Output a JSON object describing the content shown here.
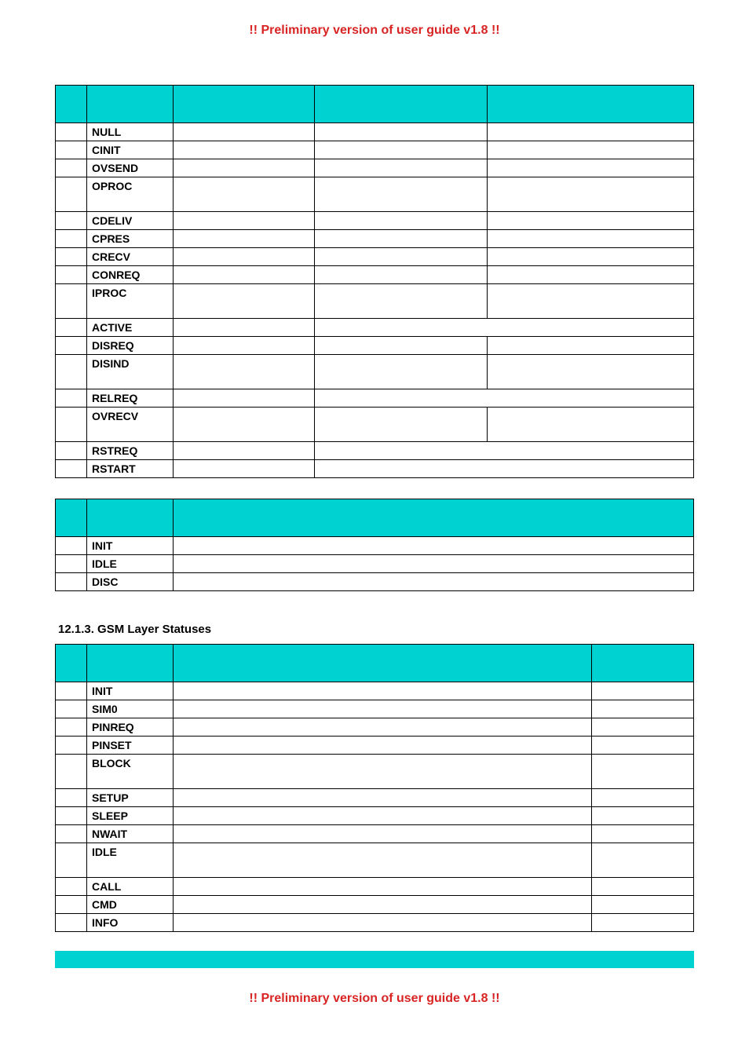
{
  "banner_top": "!! Preliminary version of user guide v1.8 !!",
  "banner_bottom": "!! Preliminary version of user guide v1.8 !!",
  "section1": {
    "headers": [
      "",
      "",
      "",
      "",
      ""
    ],
    "rows": [
      {
        "id": "",
        "code": "NULL",
        "c3": "",
        "c4": "",
        "c5": "",
        "tall": false
      },
      {
        "id": "",
        "code": "CINIT",
        "c3": "",
        "c4": "",
        "c5": "",
        "tall": false
      },
      {
        "id": "",
        "code": "OVSEND",
        "c3": "",
        "c4": "",
        "c5": "",
        "tall": false
      },
      {
        "id": "",
        "code": "OPROC",
        "c3": "",
        "c4": "",
        "c5": "",
        "tall": true
      },
      {
        "id": "",
        "code": "CDELIV",
        "c3": "",
        "c4": "",
        "c5": "",
        "tall": false
      },
      {
        "id": "",
        "code": "CPRES",
        "c3": "",
        "c4": "",
        "c5": "",
        "tall": false
      },
      {
        "id": "",
        "code": "CRECV",
        "c3": "",
        "c4": "",
        "c5": "",
        "tall": false
      },
      {
        "id": "",
        "code": "CONREQ",
        "c3": "",
        "c4": "",
        "c5": "",
        "tall": false
      },
      {
        "id": "",
        "code": "IPROC",
        "c3": "",
        "c4": "",
        "c5": "",
        "tall": true
      },
      {
        "id": "",
        "code": "ACTIVE",
        "c3": "",
        "c45": "",
        "span45": true,
        "tall": false
      },
      {
        "id": "",
        "code": "DISREQ",
        "c3": "",
        "c4": "",
        "c5": "",
        "tall": false
      },
      {
        "id": "",
        "code": "DISIND",
        "c3": "",
        "c4": "",
        "c5": "",
        "tall": true
      },
      {
        "id": "",
        "code": "RELREQ",
        "c3": "",
        "c45": "",
        "span45": true,
        "tall": false
      },
      {
        "id": "",
        "code": "OVRECV",
        "c3": "",
        "c4": "",
        "c5": "",
        "tall": true
      },
      {
        "id": "",
        "code": "RSTREQ",
        "c3": "",
        "c45": "",
        "span45": true,
        "tall": false
      },
      {
        "id": "",
        "code": "RSTART",
        "c3": "",
        "c45": "",
        "span45": true,
        "tall": false
      }
    ]
  },
  "section2": {
    "headers": [
      "",
      "",
      ""
    ],
    "rows": [
      {
        "id": "",
        "code": "INIT",
        "c3": ""
      },
      {
        "id": "",
        "code": "IDLE",
        "c3": ""
      },
      {
        "id": "",
        "code": "DISC",
        "c3": ""
      }
    ]
  },
  "section3_title": "12.1.3.   GSM Layer Statuses",
  "section3": {
    "headers": [
      "",
      "",
      "",
      ""
    ],
    "rows": [
      {
        "id": "",
        "code": "INIT",
        "c3": "",
        "c4": "",
        "tall": false
      },
      {
        "id": "",
        "code": "SIM0",
        "c3": "",
        "c4": "",
        "tall": false
      },
      {
        "id": "",
        "code": "PINREQ",
        "c3": "",
        "c4": "",
        "tall": false
      },
      {
        "id": "",
        "code": "PINSET",
        "c3": "",
        "c4": "",
        "tall": false
      },
      {
        "id": "",
        "code": "BLOCK",
        "c3": "",
        "c4": "",
        "tall": true
      },
      {
        "id": "",
        "code": "SETUP",
        "c3": "",
        "c4": "",
        "tall": false
      },
      {
        "id": "",
        "code": "SLEEP",
        "c3": "",
        "c4": "",
        "tall": false
      },
      {
        "id": "",
        "code": "NWAIT",
        "c3": "",
        "c4": "",
        "tall": false
      },
      {
        "id": "",
        "code": "IDLE",
        "c3": "",
        "c4": "",
        "tall": true
      },
      {
        "id": "",
        "code": "CALL",
        "c3": "",
        "c4": "",
        "tall": false
      },
      {
        "id": "",
        "code": "CMD",
        "c3": "",
        "c4": "",
        "tall": false
      },
      {
        "id": "",
        "code": "INFO",
        "c3": "",
        "c4": "",
        "tall": false
      }
    ]
  }
}
